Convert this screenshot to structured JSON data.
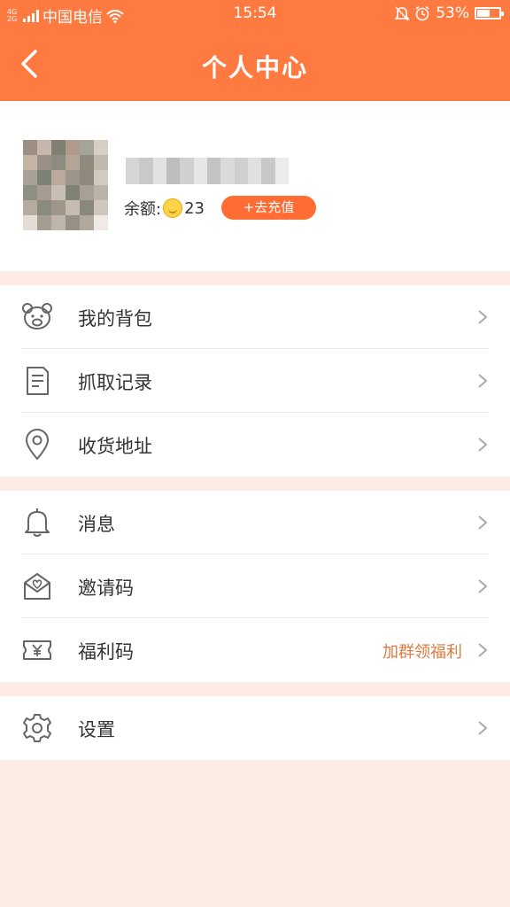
{
  "status_bar": {
    "network": "4G 2G",
    "carrier": "中国电信",
    "time": "15:54",
    "battery_percent": "53%",
    "battery_level": 0.53,
    "icons": [
      "signal-icon",
      "wifi-icon",
      "mute-bell-icon",
      "alarm-icon",
      "battery-icon"
    ]
  },
  "header": {
    "title": "个人中心",
    "back_icon": "chevron-left-icon",
    "color": "#ff7a40"
  },
  "profile": {
    "balance_label": "余额:",
    "balance_value": "23",
    "recharge_label": "+去充值"
  },
  "menu_groups": [
    [
      {
        "label": "我的背包",
        "icon": "bear-icon"
      },
      {
        "label": "抓取记录",
        "icon": "document-icon"
      },
      {
        "label": "收货地址",
        "icon": "location-pin-icon"
      }
    ],
    [
      {
        "label": "消息",
        "icon": "bell-icon"
      },
      {
        "label": "邀请码",
        "icon": "envelope-heart-icon"
      },
      {
        "label": "福利码",
        "icon": "coupon-yen-icon",
        "extra": "加群领福利"
      }
    ],
    [
      {
        "label": "设置",
        "icon": "gear-icon"
      }
    ]
  ],
  "colors": {
    "accent": "#ff7a40",
    "button": "#ff6d35",
    "page_background": "#fdece5",
    "extra_text": "#e07a3e"
  }
}
